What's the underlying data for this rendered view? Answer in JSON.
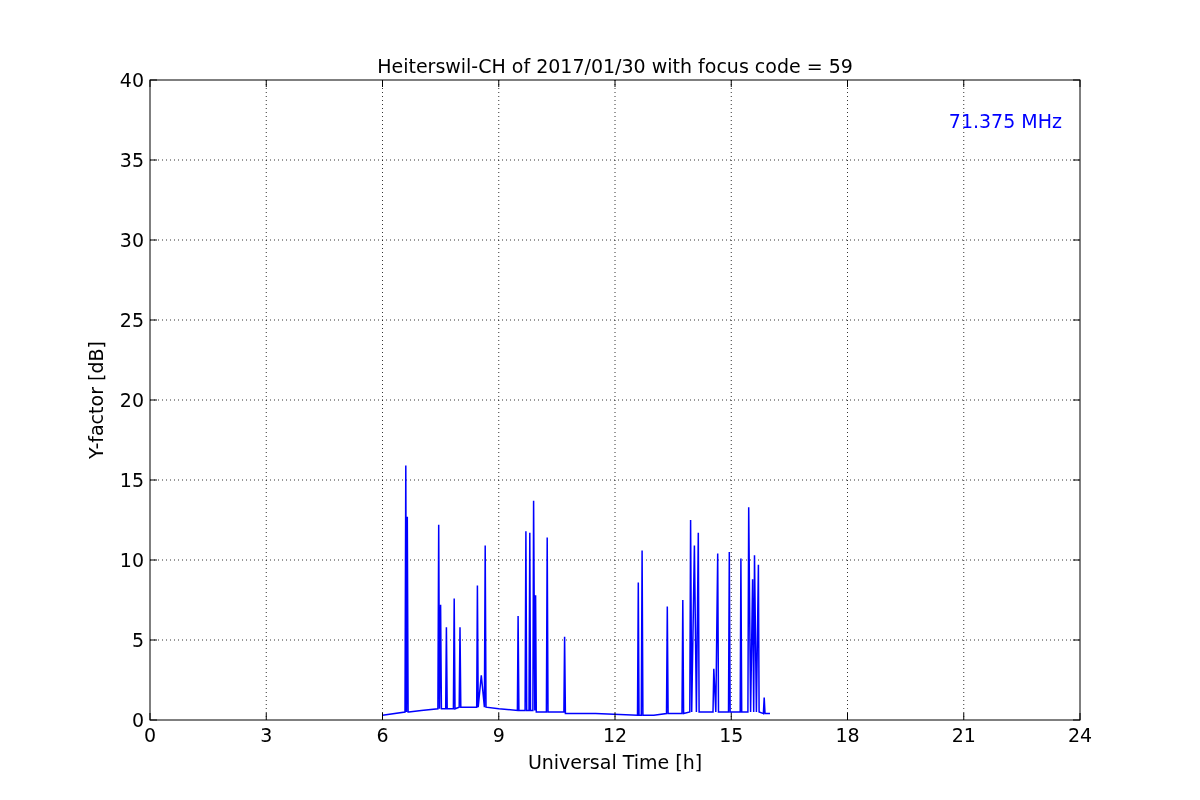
{
  "figure": {
    "chart_data": {
      "type": "line",
      "title": "Heiterswil-CH of 2017/01/30 with focus code = 59",
      "xlabel": "Universal Time [h]",
      "ylabel": "Y-factor [dB]",
      "xlim": [
        0,
        24
      ],
      "ylim": [
        0,
        40
      ],
      "xticks": [
        0,
        3,
        6,
        9,
        12,
        15,
        18,
        21,
        24
      ],
      "yticks": [
        0,
        5,
        10,
        15,
        20,
        25,
        30,
        35,
        40
      ],
      "x": [
        6.0,
        6.58,
        6.6,
        6.62,
        6.64,
        6.66,
        6.68,
        7.0,
        7.43,
        7.45,
        7.47,
        7.5,
        7.52,
        7.63,
        7.65,
        7.67,
        7.83,
        7.85,
        7.87,
        7.98,
        8.0,
        8.02,
        8.43,
        8.45,
        8.47,
        8.55,
        8.63,
        8.65,
        8.67,
        9.0,
        9.48,
        9.5,
        9.52,
        9.68,
        9.7,
        9.72,
        9.78,
        9.8,
        9.82,
        9.88,
        9.9,
        9.93,
        9.95,
        9.97,
        10.23,
        10.25,
        10.27,
        10.68,
        10.7,
        10.72,
        11.5,
        12.58,
        12.6,
        12.62,
        12.68,
        12.7,
        12.72,
        13.0,
        13.33,
        13.35,
        13.37,
        13.73,
        13.75,
        13.77,
        13.93,
        13.95,
        13.98,
        14.05,
        14.1,
        14.15,
        14.17,
        14.53,
        14.55,
        14.6,
        14.65,
        14.67,
        14.93,
        14.95,
        14.97,
        15.23,
        15.25,
        15.27,
        15.43,
        15.45,
        15.5,
        15.55,
        15.58,
        15.6,
        15.65,
        15.7,
        15.72,
        15.83,
        15.85,
        15.87,
        16.0
      ],
      "series": [
        {
          "color": "#0000ff",
          "values": [
            0.3,
            0.5,
            15.9,
            0.5,
            12.7,
            0.5,
            0.5,
            0.6,
            0.7,
            12.2,
            0.7,
            7.2,
            0.7,
            0.7,
            5.8,
            0.7,
            0.7,
            7.6,
            0.7,
            0.8,
            5.8,
            0.8,
            0.8,
            8.4,
            0.8,
            2.8,
            0.8,
            10.9,
            0.8,
            0.7,
            0.6,
            6.5,
            0.6,
            0.6,
            11.8,
            0.6,
            0.6,
            11.7,
            0.6,
            0.6,
            13.7,
            0.6,
            7.8,
            0.5,
            0.5,
            11.4,
            0.5,
            0.5,
            5.2,
            0.4,
            0.4,
            0.3,
            8.6,
            0.3,
            0.3,
            10.6,
            0.3,
            0.3,
            0.4,
            7.1,
            0.4,
            0.4,
            7.5,
            0.4,
            0.5,
            12.5,
            0.5,
            10.9,
            0.5,
            11.7,
            0.5,
            0.5,
            3.2,
            0.5,
            10.4,
            0.5,
            0.5,
            10.5,
            0.5,
            0.5,
            10.1,
            0.5,
            0.5,
            13.3,
            0.5,
            8.8,
            0.5,
            10.3,
            0.5,
            9.7,
            0.5,
            0.4,
            1.4,
            0.4,
            0.4
          ]
        }
      ],
      "grid": true,
      "annotations": [
        {
          "text": "71.375 MHz"
        }
      ]
    }
  }
}
